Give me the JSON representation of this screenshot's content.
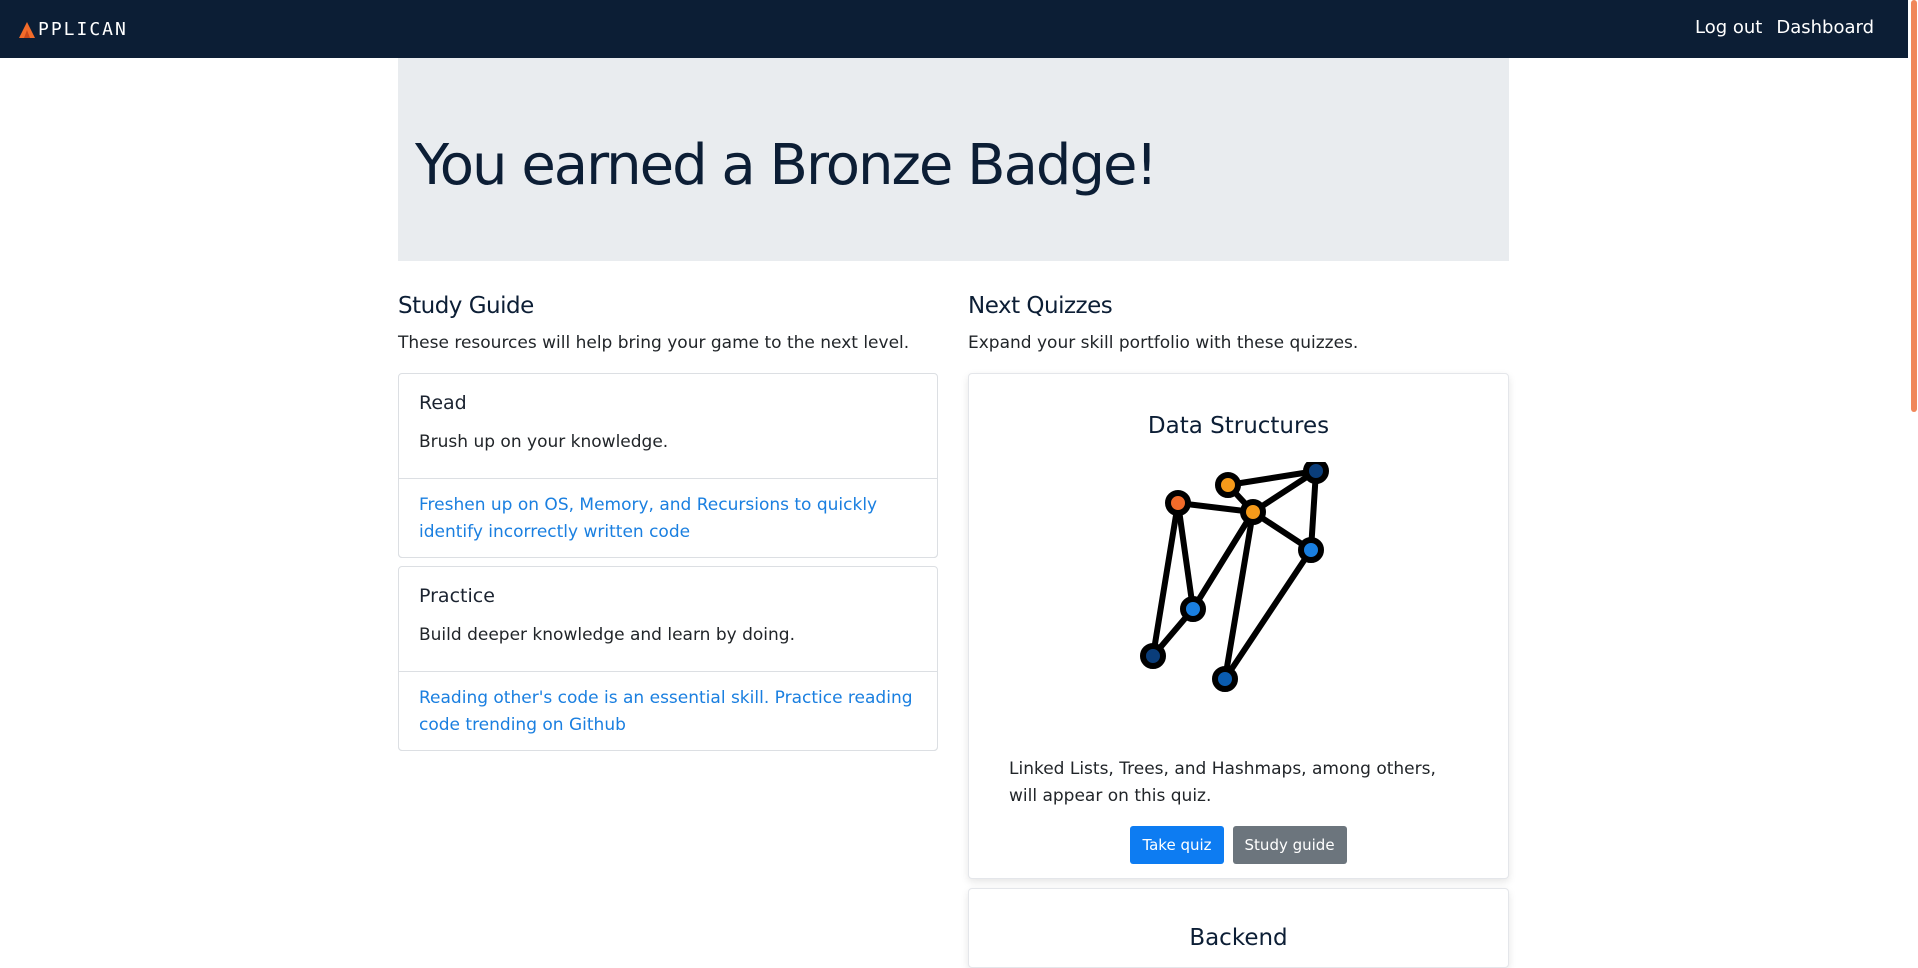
{
  "nav": {
    "brand": "PPLICAN",
    "links": [
      "Log out",
      "Dashboard"
    ]
  },
  "hero": {
    "title": "You earned a Bronze Badge!"
  },
  "study_guide": {
    "title": "Study Guide",
    "subtitle": "These resources will help bring your game to the next level.",
    "cards": [
      {
        "title": "Read",
        "text": "Brush up on your knowledge.",
        "link": "Freshen up on OS, Memory, and Recursions to quickly identify incorrectly written code"
      },
      {
        "title": "Practice",
        "text": "Build deeper knowledge and learn by doing.",
        "link": "Reading other's code is an essential skill. Practice reading code trending on Github"
      }
    ]
  },
  "next_quizzes": {
    "title": "Next Quizzes",
    "subtitle": "Expand your skill portfolio with these quizzes.",
    "quizzes": [
      {
        "title": "Data Structures",
        "description": "Linked Lists, Trees, and Hashmaps, among others, will appear on this quiz.",
        "take_label": "Take quiz",
        "guide_label": "Study guide",
        "icon": "graph-network-icon"
      },
      {
        "title": "Backend",
        "icon": "partially-visible"
      }
    ]
  },
  "colors": {
    "navbar": "#0c1e35",
    "hero_bg": "#e9ecef",
    "link": "#1a7fe0",
    "primary": "#0d7cf2",
    "secondary": "#6c757d",
    "brand_accent": "#f26b2a",
    "scroll_thumb": "#f0875a"
  }
}
